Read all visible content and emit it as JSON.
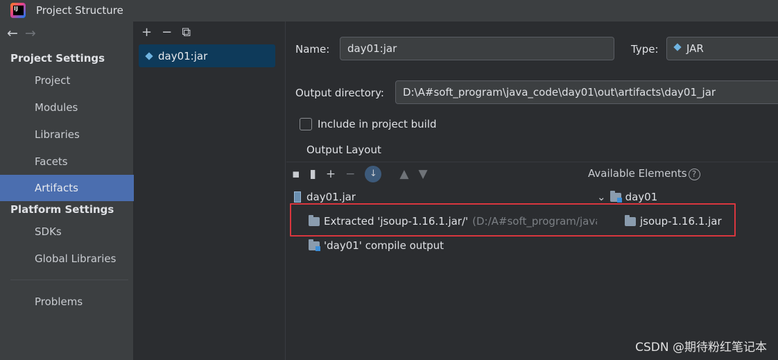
{
  "window": {
    "title": "Project Structure"
  },
  "sidebar": {
    "project_settings_header": "Project Settings",
    "project_items": [
      {
        "label": "Project"
      },
      {
        "label": "Modules"
      },
      {
        "label": "Libraries"
      },
      {
        "label": "Facets"
      },
      {
        "label": "Artifacts",
        "selected": true
      }
    ],
    "platform_settings_header": "Platform Settings",
    "platform_items": [
      {
        "label": "SDKs"
      },
      {
        "label": "Global Libraries"
      }
    ],
    "problems_label": "Problems"
  },
  "artifacts": {
    "toolbar": {
      "add": "+",
      "remove": "−",
      "copy": "⧉"
    },
    "items": [
      {
        "label": "day01:jar"
      }
    ]
  },
  "details": {
    "name_label": "Name:",
    "name_value": "day01:jar",
    "type_label": "Type:",
    "type_value": "JAR",
    "output_dir_label": "Output directory:",
    "output_dir_value": "D:\\A#soft_program\\java_code\\day01\\out\\artifacts\\day01_jar",
    "include_in_build_label": "Include in project build",
    "include_in_build_checked": false,
    "output_layout_tab": "Output Layout",
    "available_elements_label": "Available Elements",
    "help": "?"
  },
  "layout_tree": {
    "root": "day01.jar",
    "extracted": {
      "label": "Extracted 'jsoup-1.16.1.jar/'",
      "path_hint": "(D:/A#soft_program/java"
    },
    "compile_output": "'day01' compile output"
  },
  "available_tree": {
    "module": "day01",
    "library": "jsoup-1.16.1.jar"
  },
  "watermark": "CSDN @期待粉红笔记本",
  "colors": {
    "selected_bg": "#4b6eaf",
    "highlight_box": "#d9363e",
    "accent": "#3b8ed8"
  }
}
